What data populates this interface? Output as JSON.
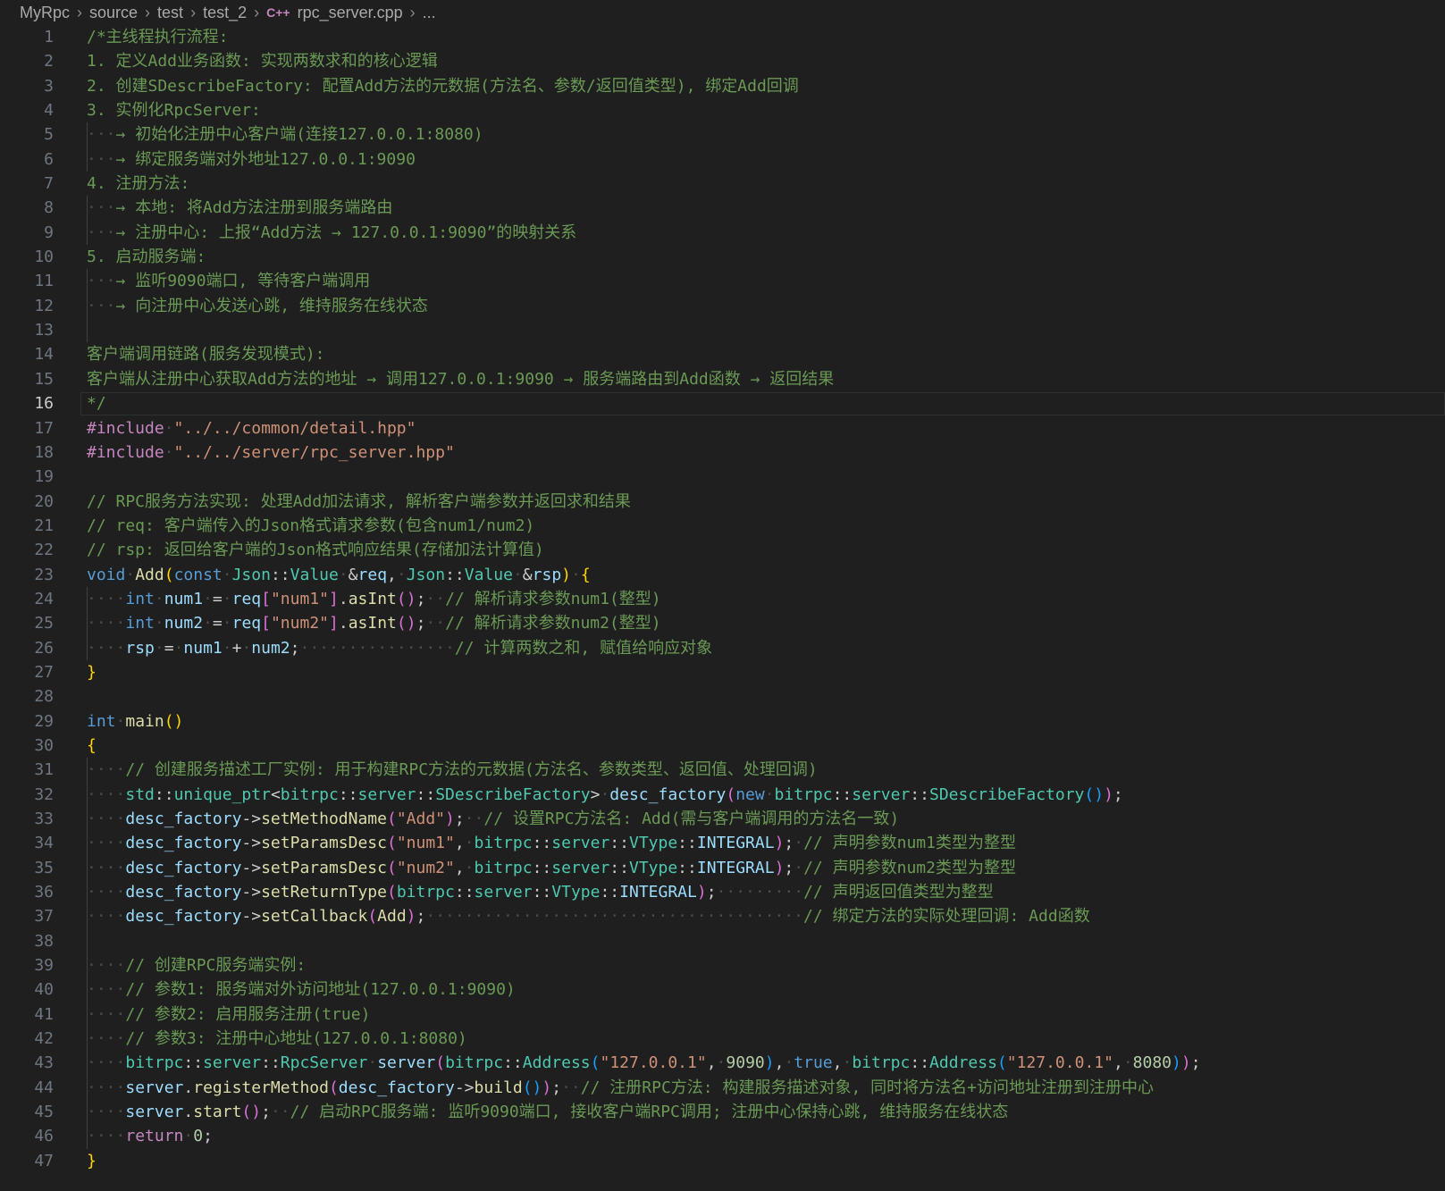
{
  "breadcrumb": [
    "MyRpc",
    "source",
    "test",
    "test_2",
    "rpc_server.cpp",
    "..."
  ],
  "icons": {
    "file_icon": "cpp-file-icon",
    "separator": "chevron-right-icon"
  },
  "colors": {
    "background": "#1f1f1f",
    "comment": "#6a9955",
    "keyword": "#569cd6",
    "type": "#4ec9b0",
    "function": "#dcdcaa",
    "variable": "#9cdcfe",
    "string": "#ce9178",
    "number": "#b5cea8"
  },
  "active_line": 16,
  "lines": [
    [
      [
        "com",
        "/*主线程执行流程:"
      ]
    ],
    [
      [
        "com",
        "1. 定义Add业务函数: 实现两数求和的核心逻辑"
      ]
    ],
    [
      [
        "com",
        "2. 创建SDescribeFactory: 配置Add方法的元数据(方法名、参数/返回值类型), 绑定Add回调"
      ]
    ],
    [
      [
        "com",
        "3. 实例化RpcServer:"
      ]
    ],
    [
      [
        "ws",
        "···"
      ],
      [
        "com",
        "→ 初始化注册中心客户端(连接127.0.0.1:8080)"
      ]
    ],
    [
      [
        "ws",
        "···"
      ],
      [
        "com",
        "→ 绑定服务端对外地址127.0.0.1:9090"
      ]
    ],
    [
      [
        "com",
        "4. 注册方法:"
      ]
    ],
    [
      [
        "ws",
        "···"
      ],
      [
        "com",
        "→ 本地: 将Add方法注册到服务端路由"
      ]
    ],
    [
      [
        "ws",
        "···"
      ],
      [
        "com",
        "→ 注册中心: 上报“Add方法 → 127.0.0.1:9090”的映射关系"
      ]
    ],
    [
      [
        "com",
        "5. 启动服务端:"
      ]
    ],
    [
      [
        "ws",
        "···"
      ],
      [
        "com",
        "→ 监听9090端口, 等待客户端调用"
      ]
    ],
    [
      [
        "ws",
        "···"
      ],
      [
        "com",
        "→ 向注册中心发送心跳, 维持服务在线状态"
      ]
    ],
    [],
    [
      [
        "com",
        "客户端调用链路(服务发现模式):"
      ]
    ],
    [
      [
        "com",
        "客户端从注册中心获取Add方法的地址 → 调用127.0.0.1:9090 → 服务端路由到Add函数 → 返回结果"
      ]
    ],
    [
      [
        "com",
        "*/"
      ]
    ],
    [
      [
        "mac",
        "#include"
      ],
      [
        "ws",
        "·"
      ],
      [
        "str",
        "\"../../common/detail.hpp\""
      ]
    ],
    [
      [
        "mac",
        "#include"
      ],
      [
        "ws",
        "·"
      ],
      [
        "str",
        "\"../../server/rpc_server.hpp\""
      ]
    ],
    [],
    [
      [
        "com",
        "// RPC服务方法实现: 处理Add加法请求, 解析客户端参数并返回求和结果"
      ]
    ],
    [
      [
        "com",
        "// req: 客户端传入的Json格式请求参数(包含num1/num2)"
      ]
    ],
    [
      [
        "com",
        "// rsp: 返回给客户端的Json格式响应结果(存储加法计算值)"
      ]
    ],
    [
      [
        "kw",
        "void"
      ],
      [
        "ws",
        "·"
      ],
      [
        "fn",
        "Add"
      ],
      [
        "br1",
        "("
      ],
      [
        "kw",
        "const"
      ],
      [
        "ws",
        "·"
      ],
      [
        "type",
        "Json"
      ],
      [
        "txt",
        "::"
      ],
      [
        "type",
        "Value"
      ],
      [
        "ws",
        "·"
      ],
      [
        "txt",
        "&"
      ],
      [
        "var",
        "req"
      ],
      [
        "txt",
        ","
      ],
      [
        "ws",
        "·"
      ],
      [
        "type",
        "Json"
      ],
      [
        "txt",
        "::"
      ],
      [
        "type",
        "Value"
      ],
      [
        "ws",
        "·"
      ],
      [
        "txt",
        "&"
      ],
      [
        "var",
        "rsp"
      ],
      [
        "br1",
        ")"
      ],
      [
        "ws",
        "·"
      ],
      [
        "br1",
        "{"
      ]
    ],
    [
      [
        "ws",
        "····"
      ],
      [
        "kw",
        "int"
      ],
      [
        "ws",
        "·"
      ],
      [
        "var",
        "num1"
      ],
      [
        "ws",
        "·"
      ],
      [
        "txt",
        "="
      ],
      [
        "ws",
        "·"
      ],
      [
        "var",
        "req"
      ],
      [
        "br2",
        "["
      ],
      [
        "str",
        "\"num1\""
      ],
      [
        "br2",
        "]"
      ],
      [
        "txt",
        "."
      ],
      [
        "fn",
        "asInt"
      ],
      [
        "br2",
        "()"
      ],
      [
        "txt",
        ";"
      ],
      [
        "ws",
        "··"
      ],
      [
        "com",
        "// 解析请求参数num1(整型)"
      ]
    ],
    [
      [
        "ws",
        "····"
      ],
      [
        "kw",
        "int"
      ],
      [
        "ws",
        "·"
      ],
      [
        "var",
        "num2"
      ],
      [
        "ws",
        "·"
      ],
      [
        "txt",
        "="
      ],
      [
        "ws",
        "·"
      ],
      [
        "var",
        "req"
      ],
      [
        "br2",
        "["
      ],
      [
        "str",
        "\"num2\""
      ],
      [
        "br2",
        "]"
      ],
      [
        "txt",
        "."
      ],
      [
        "fn",
        "asInt"
      ],
      [
        "br2",
        "()"
      ],
      [
        "txt",
        ";"
      ],
      [
        "ws",
        "··"
      ],
      [
        "com",
        "// 解析请求参数num2(整型)"
      ]
    ],
    [
      [
        "ws",
        "····"
      ],
      [
        "var",
        "rsp"
      ],
      [
        "ws",
        "·"
      ],
      [
        "txt",
        "="
      ],
      [
        "ws",
        "·"
      ],
      [
        "var",
        "num1"
      ],
      [
        "ws",
        "·"
      ],
      [
        "txt",
        "+"
      ],
      [
        "ws",
        "·"
      ],
      [
        "var",
        "num2"
      ],
      [
        "txt",
        ";"
      ],
      [
        "ws",
        "················"
      ],
      [
        "com",
        "// 计算两数之和, 赋值给响应对象"
      ]
    ],
    [
      [
        "br1",
        "}"
      ]
    ],
    [],
    [
      [
        "kw",
        "int"
      ],
      [
        "ws",
        "·"
      ],
      [
        "fn",
        "main"
      ],
      [
        "br1",
        "()"
      ]
    ],
    [
      [
        "br1",
        "{"
      ]
    ],
    [
      [
        "ws",
        "····"
      ],
      [
        "com",
        "// 创建服务描述工厂实例: 用于构建RPC方法的元数据(方法名、参数类型、返回值、处理回调)"
      ]
    ],
    [
      [
        "ws",
        "····"
      ],
      [
        "type",
        "std"
      ],
      [
        "txt",
        "::"
      ],
      [
        "type",
        "unique_ptr"
      ],
      [
        "txt",
        "<"
      ],
      [
        "type",
        "bitrpc"
      ],
      [
        "txt",
        "::"
      ],
      [
        "type",
        "server"
      ],
      [
        "txt",
        "::"
      ],
      [
        "type",
        "SDescribeFactory"
      ],
      [
        "txt",
        ">"
      ],
      [
        "ws",
        "·"
      ],
      [
        "var",
        "desc_factory"
      ],
      [
        "br2",
        "("
      ],
      [
        "kw",
        "new"
      ],
      [
        "ws",
        "·"
      ],
      [
        "type",
        "bitrpc"
      ],
      [
        "txt",
        "::"
      ],
      [
        "type",
        "server"
      ],
      [
        "txt",
        "::"
      ],
      [
        "type",
        "SDescribeFactory"
      ],
      [
        "br3",
        "()"
      ],
      [
        "br2",
        ")"
      ],
      [
        "txt",
        ";"
      ]
    ],
    [
      [
        "ws",
        "····"
      ],
      [
        "var",
        "desc_factory"
      ],
      [
        "txt",
        "->"
      ],
      [
        "fn",
        "setMethodName"
      ],
      [
        "br2",
        "("
      ],
      [
        "str",
        "\"Add\""
      ],
      [
        "br2",
        ")"
      ],
      [
        "txt",
        ";"
      ],
      [
        "ws",
        "··"
      ],
      [
        "com",
        "// 设置RPC方法名: Add(需与客户端调用的方法名一致)"
      ]
    ],
    [
      [
        "ws",
        "····"
      ],
      [
        "var",
        "desc_factory"
      ],
      [
        "txt",
        "->"
      ],
      [
        "fn",
        "setParamsDesc"
      ],
      [
        "br2",
        "("
      ],
      [
        "str",
        "\"num1\""
      ],
      [
        "txt",
        ","
      ],
      [
        "ws",
        "·"
      ],
      [
        "type",
        "bitrpc"
      ],
      [
        "txt",
        "::"
      ],
      [
        "type",
        "server"
      ],
      [
        "txt",
        "::"
      ],
      [
        "type",
        "VType"
      ],
      [
        "txt",
        "::"
      ],
      [
        "var",
        "INTEGRAL"
      ],
      [
        "br2",
        ")"
      ],
      [
        "txt",
        ";"
      ],
      [
        "ws",
        "·"
      ],
      [
        "com",
        "// 声明参数num1类型为整型"
      ]
    ],
    [
      [
        "ws",
        "····"
      ],
      [
        "var",
        "desc_factory"
      ],
      [
        "txt",
        "->"
      ],
      [
        "fn",
        "setParamsDesc"
      ],
      [
        "br2",
        "("
      ],
      [
        "str",
        "\"num2\""
      ],
      [
        "txt",
        ","
      ],
      [
        "ws",
        "·"
      ],
      [
        "type",
        "bitrpc"
      ],
      [
        "txt",
        "::"
      ],
      [
        "type",
        "server"
      ],
      [
        "txt",
        "::"
      ],
      [
        "type",
        "VType"
      ],
      [
        "txt",
        "::"
      ],
      [
        "var",
        "INTEGRAL"
      ],
      [
        "br2",
        ")"
      ],
      [
        "txt",
        ";"
      ],
      [
        "ws",
        "·"
      ],
      [
        "com",
        "// 声明参数num2类型为整型"
      ]
    ],
    [
      [
        "ws",
        "····"
      ],
      [
        "var",
        "desc_factory"
      ],
      [
        "txt",
        "->"
      ],
      [
        "fn",
        "setReturnType"
      ],
      [
        "br2",
        "("
      ],
      [
        "type",
        "bitrpc"
      ],
      [
        "txt",
        "::"
      ],
      [
        "type",
        "server"
      ],
      [
        "txt",
        "::"
      ],
      [
        "type",
        "VType"
      ],
      [
        "txt",
        "::"
      ],
      [
        "var",
        "INTEGRAL"
      ],
      [
        "br2",
        ")"
      ],
      [
        "txt",
        ";"
      ],
      [
        "ws",
        "·········"
      ],
      [
        "com",
        "// 声明返回值类型为整型"
      ]
    ],
    [
      [
        "ws",
        "····"
      ],
      [
        "var",
        "desc_factory"
      ],
      [
        "txt",
        "->"
      ],
      [
        "fn",
        "setCallback"
      ],
      [
        "br2",
        "("
      ],
      [
        "fn",
        "Add"
      ],
      [
        "br2",
        ")"
      ],
      [
        "txt",
        ";"
      ],
      [
        "ws",
        "·······································"
      ],
      [
        "com",
        "// 绑定方法的实际处理回调: Add函数"
      ]
    ],
    [],
    [
      [
        "ws",
        "····"
      ],
      [
        "com",
        "// 创建RPC服务端实例:"
      ]
    ],
    [
      [
        "ws",
        "····"
      ],
      [
        "com",
        "// 参数1: 服务端对外访问地址(127.0.0.1:9090)"
      ]
    ],
    [
      [
        "ws",
        "····"
      ],
      [
        "com",
        "// 参数2: 启用服务注册(true)"
      ]
    ],
    [
      [
        "ws",
        "····"
      ],
      [
        "com",
        "// 参数3: 注册中心地址(127.0.0.1:8080)"
      ]
    ],
    [
      [
        "ws",
        "····"
      ],
      [
        "type",
        "bitrpc"
      ],
      [
        "txt",
        "::"
      ],
      [
        "type",
        "server"
      ],
      [
        "txt",
        "::"
      ],
      [
        "type",
        "RpcServer"
      ],
      [
        "ws",
        "·"
      ],
      [
        "var",
        "server"
      ],
      [
        "br2",
        "("
      ],
      [
        "type",
        "bitrpc"
      ],
      [
        "txt",
        "::"
      ],
      [
        "type",
        "Address"
      ],
      [
        "br3",
        "("
      ],
      [
        "str",
        "\"127.0.0.1\""
      ],
      [
        "txt",
        ","
      ],
      [
        "ws",
        "·"
      ],
      [
        "num",
        "9090"
      ],
      [
        "br3",
        ")"
      ],
      [
        "txt",
        ","
      ],
      [
        "ws",
        "·"
      ],
      [
        "kw",
        "true"
      ],
      [
        "txt",
        ","
      ],
      [
        "ws",
        "·"
      ],
      [
        "type",
        "bitrpc"
      ],
      [
        "txt",
        "::"
      ],
      [
        "type",
        "Address"
      ],
      [
        "br3",
        "("
      ],
      [
        "str",
        "\"127.0.0.1\""
      ],
      [
        "txt",
        ","
      ],
      [
        "ws",
        "·"
      ],
      [
        "num",
        "8080"
      ],
      [
        "br3",
        ")"
      ],
      [
        "br2",
        ")"
      ],
      [
        "txt",
        ";"
      ]
    ],
    [
      [
        "ws",
        "····"
      ],
      [
        "var",
        "server"
      ],
      [
        "txt",
        "."
      ],
      [
        "fn",
        "registerMethod"
      ],
      [
        "br2",
        "("
      ],
      [
        "var",
        "desc_factory"
      ],
      [
        "txt",
        "->"
      ],
      [
        "fn",
        "build"
      ],
      [
        "br3",
        "()"
      ],
      [
        "br2",
        ")"
      ],
      [
        "txt",
        ";"
      ],
      [
        "ws",
        "··"
      ],
      [
        "com",
        "// 注册RPC方法: 构建服务描述对象, 同时将方法名+访问地址注册到注册中心"
      ]
    ],
    [
      [
        "ws",
        "····"
      ],
      [
        "var",
        "server"
      ],
      [
        "txt",
        "."
      ],
      [
        "fn",
        "start"
      ],
      [
        "br2",
        "()"
      ],
      [
        "txt",
        ";"
      ],
      [
        "ws",
        "··"
      ],
      [
        "com",
        "// 启动RPC服务端: 监听9090端口, 接收客户端RPC调用; 注册中心保持心跳, 维持服务在线状态"
      ]
    ],
    [
      [
        "ws",
        "····"
      ],
      [
        "ctrl",
        "return"
      ],
      [
        "ws",
        "·"
      ],
      [
        "num",
        "0"
      ],
      [
        "txt",
        ";"
      ]
    ],
    [
      [
        "br1",
        "}"
      ]
    ]
  ]
}
